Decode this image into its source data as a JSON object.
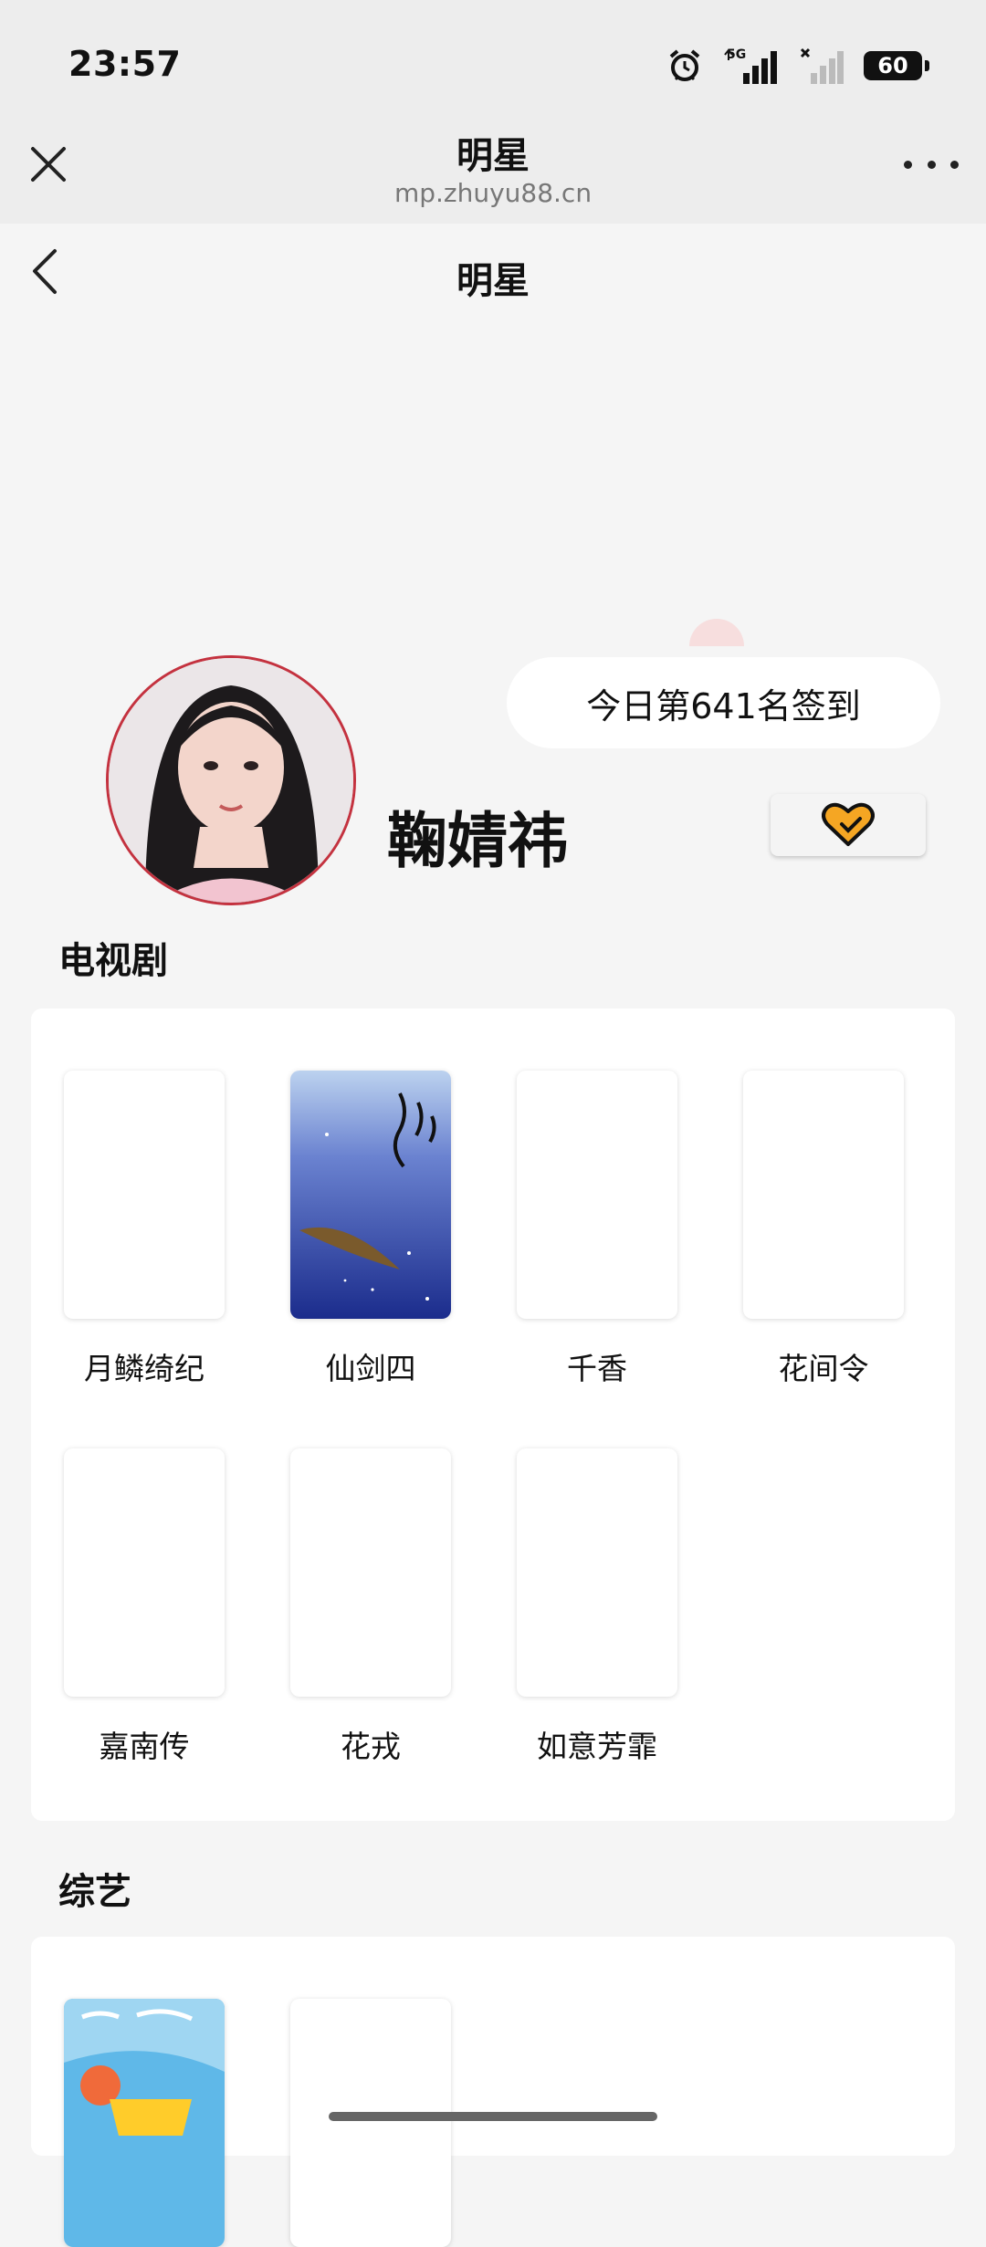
{
  "status_bar": {
    "time": "23:57",
    "network": "5G",
    "battery": "60"
  },
  "web_header": {
    "title": "明星",
    "url": "mp.zhuyu88.cn"
  },
  "page": {
    "title": "明星"
  },
  "profile": {
    "checkin_text": "今日第641名签到",
    "name": "鞠婧祎"
  },
  "tv_section": {
    "title": "电视剧",
    "items": [
      {
        "label": "月鳞绮纪"
      },
      {
        "label": "仙剑四"
      },
      {
        "label": "千香"
      },
      {
        "label": "花间令"
      },
      {
        "label": "嘉南传"
      },
      {
        "label": "花戎"
      },
      {
        "label": "如意芳霏"
      }
    ]
  },
  "variety_section": {
    "title": "综艺"
  },
  "colors": {
    "accent_border": "#c4323f",
    "heart": "#f5a623",
    "background": "#f5f5f5"
  }
}
